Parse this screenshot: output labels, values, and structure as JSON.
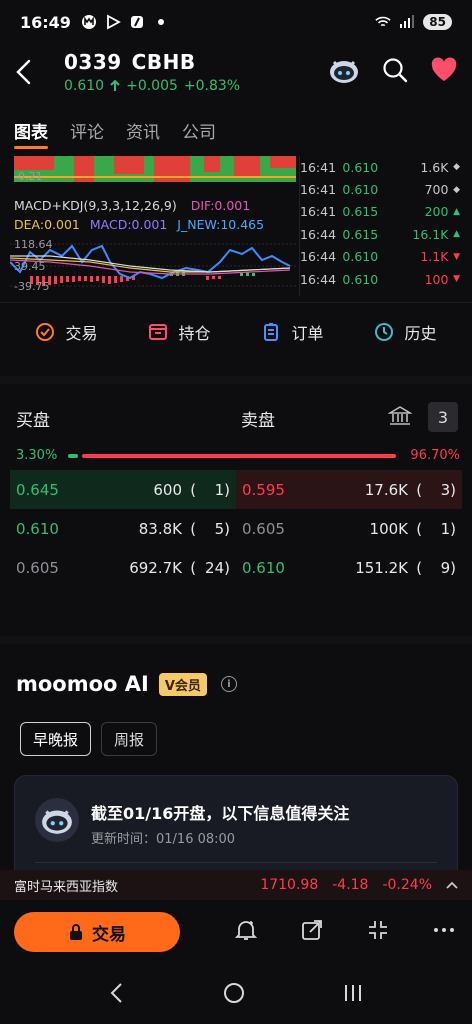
{
  "status_bar": {
    "time": "16:49",
    "battery": "85"
  },
  "header": {
    "code": "0339",
    "name": "CBHB",
    "price": "0.610",
    "change": "+0.005",
    "change_pct": "+0.83%"
  },
  "tabs": [
    {
      "label": "图表",
      "active": true
    },
    {
      "label": "评论",
      "active": false
    },
    {
      "label": "资讯",
      "active": false
    },
    {
      "label": "公司",
      "active": false
    }
  ],
  "chart": {
    "band_axis_label": "-0.21",
    "indicator_title": "MACD+KDJ(9,3,3,12,26,9)",
    "dif": "DIF:0.001",
    "dea": "DEA:0.001",
    "macd": "MACD:0.001",
    "j_new": "J_NEW:10.465",
    "axis_top": "118.64",
    "axis_mid": "39.45",
    "axis_bottom": "-39.75"
  },
  "ticks": [
    {
      "time": "16:41",
      "price": "0.610",
      "volume": "1.6K",
      "dir": "neutral"
    },
    {
      "time": "16:41",
      "price": "0.610",
      "volume": "700",
      "dir": "neutral"
    },
    {
      "time": "16:41",
      "price": "0.615",
      "volume": "200",
      "dir": "up"
    },
    {
      "time": "16:44",
      "price": "0.615",
      "volume": "16.1K",
      "dir": "up"
    },
    {
      "time": "16:44",
      "price": "0.610",
      "volume": "1.1K",
      "dir": "down"
    },
    {
      "time": "16:44",
      "price": "0.610",
      "volume": "100",
      "dir": "down"
    }
  ],
  "actions": [
    {
      "label": "交易",
      "icon": "trade-icon"
    },
    {
      "label": "持仓",
      "icon": "position-icon"
    },
    {
      "label": "订单",
      "icon": "order-icon"
    },
    {
      "label": "历史",
      "icon": "history-icon"
    }
  ],
  "order_book": {
    "buy_label": "买盘",
    "sell_label": "卖盘",
    "level_label": "3",
    "buy_pct": "3.30%",
    "sell_pct": "96.70%",
    "buy_ratio": 0.033,
    "rows": [
      {
        "bid_price": "0.645",
        "bid_vol": "600",
        "bid_count": "1",
        "ask_price": "0.595",
        "ask_vol": "17.6K",
        "ask_count": "3"
      },
      {
        "bid_price": "0.610",
        "bid_vol": "83.8K",
        "bid_count": "5",
        "ask_price": "0.605",
        "ask_vol": "100K",
        "ask_count": "1"
      },
      {
        "bid_price": "0.605",
        "bid_vol": "692.7K",
        "bid_count": "24",
        "ask_price": "0.610",
        "ask_vol": "151.2K",
        "ask_count": "9"
      }
    ]
  },
  "ai_section": {
    "title": "moomoo AI",
    "badge": "V会员",
    "pills": [
      {
        "label": "早晚报",
        "active": true
      },
      {
        "label": "周报",
        "active": false
      }
    ],
    "card_headline": "截至01/16开盘，以下信息值得关注",
    "card_updated": "更新时间：01/16 08:00"
  },
  "index_ticker": {
    "name": "富时马来西亚指数",
    "value": "1710.98",
    "change": "-4.18",
    "change_pct": "-0.24%"
  },
  "bottom_bar": {
    "trade_label": "交易"
  },
  "colors": {
    "up": "#2fbf71",
    "down": "#ff3b4e",
    "accent": "#ff6a1a",
    "background": "#0d0d0f"
  }
}
